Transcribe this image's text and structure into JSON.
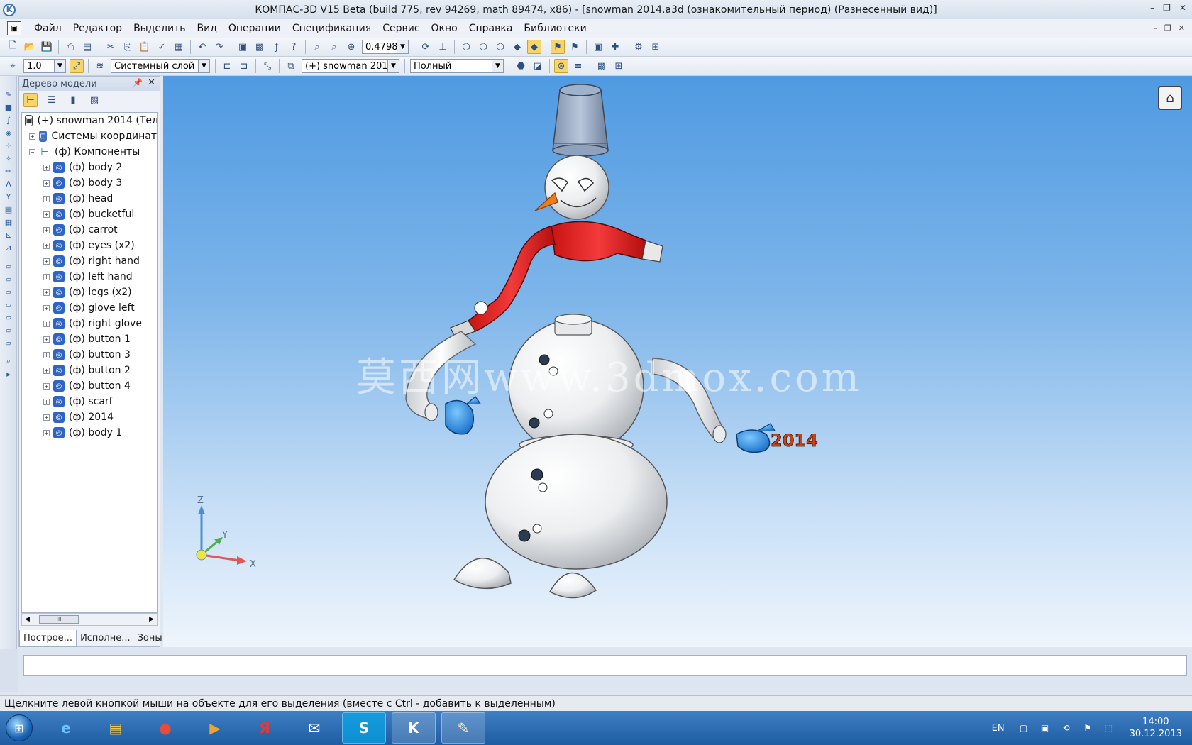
{
  "titlebar": {
    "title": "КОМПАС-3D V15 Beta (build 775, rev 94269, math 89474, x86) - [snowman 2014.a3d (ознакомительный период) (Разнесенный вид)]",
    "minimize": "–",
    "maximize": "❐",
    "close": "✕"
  },
  "menu": {
    "items": [
      "Файл",
      "Редактор",
      "Выделить",
      "Вид",
      "Операции",
      "Спецификация",
      "Сервис",
      "Окно",
      "Справка",
      "Библиотеки"
    ]
  },
  "toolbar": {
    "zoom_value": "0.4798",
    "step_value": "1.0",
    "layer": "Системный слой",
    "assembly": "(+) snowman 201",
    "render_mode": "Полный"
  },
  "tree": {
    "panel_title": "Дерево модели",
    "root": "(+) snowman 2014 (Тел-",
    "coords": "Системы координат",
    "components": "(ф) Компоненты",
    "items": [
      "(ф) body 2",
      "(ф) body 3",
      "(ф) head",
      "(ф) bucketful",
      "(ф) carrot",
      "(ф) eyes (x2)",
      "(ф) right hand",
      "(ф) left hand",
      "(ф) legs (x2)",
      "(ф) glove left",
      "(ф) right glove",
      "(ф) button 1",
      "(ф) button 3",
      "(ф) button 2",
      "(ф) button 4",
      "(ф) scarf",
      "(ф) 2014",
      "(ф) body 1"
    ],
    "tabs": [
      "Построе...",
      "Исполне...",
      "Зоны"
    ],
    "scroll_thumb": "III"
  },
  "viewport": {
    "watermark": "莫西网www.3dmox.com",
    "axis_x": "X",
    "axis_y": "Y",
    "axis_z": "Z",
    "year_label": "2014"
  },
  "statusbar": {
    "text": "Щелкните левой кнопкой мыши на объекте для его выделения (вместе с Ctrl - добавить к выделенным)"
  },
  "taskbar": {
    "language": "EN",
    "time": "14:00",
    "date": "30.12.2013",
    "buttons": [
      "e",
      "▤",
      "●",
      "▶",
      "Я",
      "✉",
      "S",
      "K",
      "✎"
    ]
  }
}
